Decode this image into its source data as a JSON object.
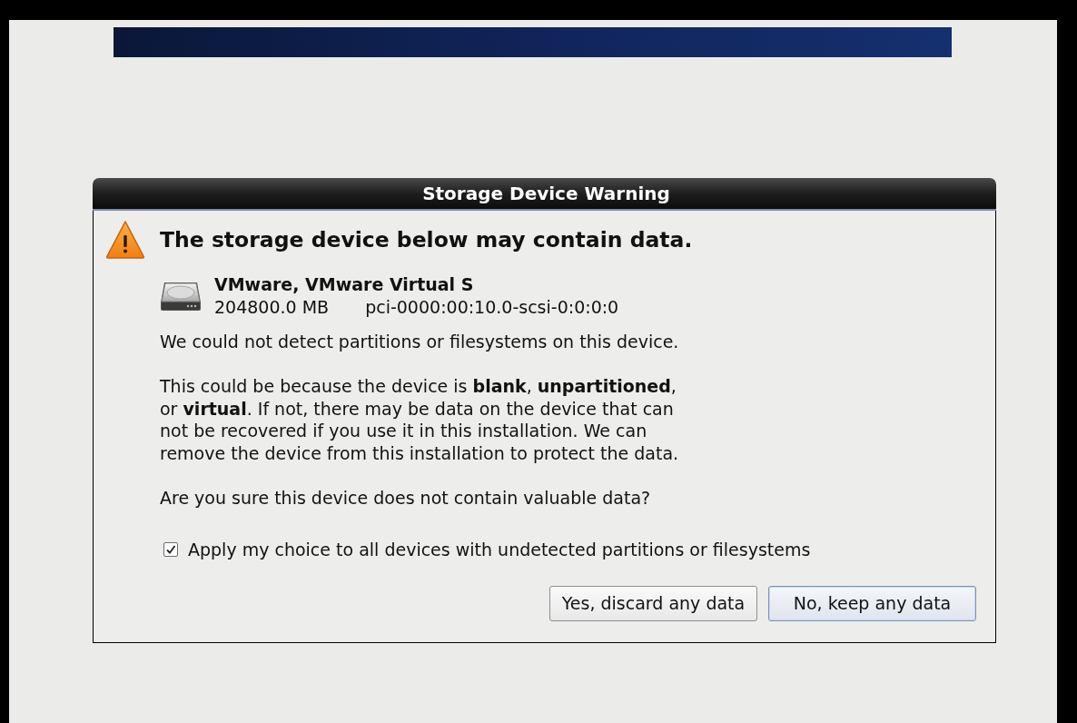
{
  "dialog": {
    "title": "Storage Device Warning",
    "heading": "The storage device below may contain data.",
    "device": {
      "name": "VMware, VMware Virtual S",
      "size": "204800.0 MB",
      "path": "pci-0000:00:10.0-scsi-0:0:0:0"
    },
    "paragraphs": [
      "We could not detect partitions or filesystems on this device.",
      "This could be because the device is **blank**, **unpartitioned**, or **virtual**. If not, there may be data on the device that can not be recovered if you use it in this installation. We can remove the device from this installation to protect the data.",
      "Are you sure this device does not contain valuable data?"
    ],
    "checkbox": {
      "label": "Apply my choice to all devices with undetected partitions or filesystems",
      "checked": true
    },
    "buttons": [
      {
        "label": "Yes, discard any data",
        "default": false
      },
      {
        "label": "No, keep any data",
        "default": true
      }
    ]
  }
}
